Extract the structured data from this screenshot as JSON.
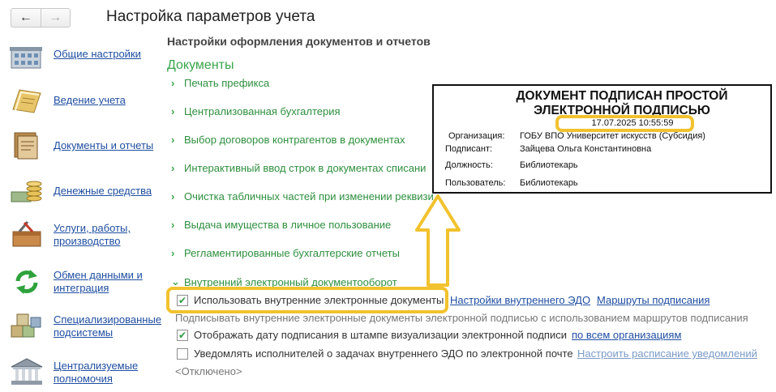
{
  "title": "Настройка параметров учета",
  "sidebar": {
    "items": [
      {
        "label": "Общие настройки",
        "icon": "building-icon"
      },
      {
        "label": "Ведение учета",
        "icon": "notebook-icon"
      },
      {
        "label": "Документы и отчеты",
        "icon": "documents-icon"
      },
      {
        "label": "Денежные средства",
        "icon": "coins-icon"
      },
      {
        "label": "Услуги, работы, производство",
        "icon": "toolbox-icon"
      },
      {
        "label": "Обмен данными и интеграция",
        "icon": "sync-icon"
      },
      {
        "label": "Специализированные подсистемы",
        "icon": "cubes-icon"
      },
      {
        "label": "Централизуемые полномочия",
        "icon": "bank-building-icon"
      }
    ]
  },
  "main": {
    "section_heading": "Настройки оформления документов и отчетов",
    "group_title": "Документы",
    "rows": [
      "Печать префикса",
      "Централизованная бухгалтерия",
      "Выбор договоров контрагентов в документах",
      "Интерактивный ввод строк в документах списани",
      "Очистка табличных частей при изменении реквизи",
      "Выдача имущества в личное пользование",
      "Регламентированные бухгалтерские отчеты",
      "Внутренний электронный документооборот"
    ],
    "use_internal_edo": {
      "label": "Использовать внутренние электронные документы",
      "checked": true
    },
    "internal_edo_settings_link": "Настройки внутреннего ЭДО",
    "signing_routes_link": "Маршруты подписания",
    "signing_hint": "Подписывать внутренние электронные документы электронной подписью с использованием маршрутов подписания",
    "show_sign_date": {
      "label": "Отображать дату подписания в штампе визуализации электронной подписи",
      "checked": true
    },
    "all_orgs_link": "по всем организациям",
    "notify_executors": {
      "label": "Уведомлять исполнителей о задачах внутреннего ЭДО по электронной почте",
      "checked": false
    },
    "notify_schedule_link": "Настроить расписание уведомлений",
    "disabled_text": "<Отключено>"
  },
  "stamp": {
    "title_line1": "ДОКУМЕНТ ПОДПИСАН ПРОСТОЙ",
    "title_line2": "ЭЛЕКТРОННОЙ ПОДПИСЬЮ",
    "date": "17.07.2025 10:55:59",
    "organization_label": "Организация:",
    "organization_value": "ГОБУ ВПО Университет искусств (Субсидия)",
    "signer_label": "Подписант:",
    "signer_value": "Зайцева Ольга Константиновна",
    "position_label": "Должность:",
    "position_value": "Библиотекарь",
    "user_label": "Пользователь:",
    "user_value": "Библиотекарь"
  },
  "colors": {
    "highlight": "#f2c22e",
    "link": "#1f4ea1",
    "green": "#3aa64a"
  }
}
